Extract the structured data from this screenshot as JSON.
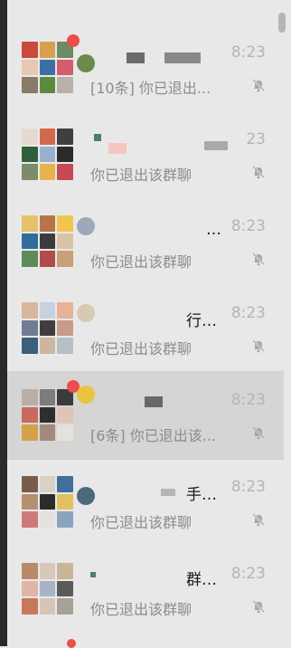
{
  "colors": {
    "background": "#e9e8e8",
    "selected_row": "#d6d5d5",
    "unread_dot": "#ee4d4d",
    "time": "#b4b4b4",
    "preview": "#8c8c8c"
  },
  "conversations": [
    {
      "title": "",
      "time": "8:23",
      "preview": "[10条] 你已退出...",
      "muted": true,
      "unread": true
    },
    {
      "title": "",
      "time": "23",
      "preview": "你已退出该群聊",
      "muted": true,
      "unread": false
    },
    {
      "title": "…",
      "time": "8:23",
      "preview": "你已退出该群聊",
      "muted": true,
      "unread": false
    },
    {
      "title": "行…",
      "time": "8:23",
      "preview": "你已退出该群聊",
      "muted": true,
      "unread": false
    },
    {
      "title": "",
      "time": "8:23",
      "preview": "[6条] 你已退出该...",
      "muted": true,
      "unread": true,
      "selected": true
    },
    {
      "title": "手…",
      "time": "8:23",
      "preview": "你已退出该群聊",
      "muted": true,
      "unread": false
    },
    {
      "title": "群…",
      "time": "8:23",
      "preview": "你已退出该群聊",
      "muted": true,
      "unread": false
    }
  ],
  "icons": {
    "mute": "bell-off-icon"
  }
}
